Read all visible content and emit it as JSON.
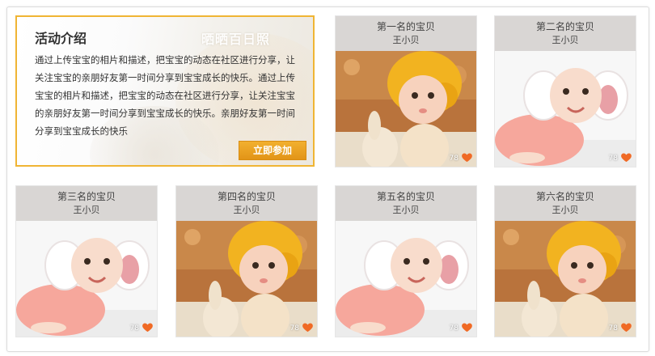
{
  "intro": {
    "title": "活动介绍",
    "watermark": "晒晒百日照",
    "body": "通过上传宝宝的相片和描述，把宝宝的动态在社区进行分享，让关注宝宝的亲朋好友第一时间分享到宝宝成长的快乐。通过上传宝宝的相片和描述，把宝宝的动态在社区进行分享，让关注宝宝的亲朋好友第一时间分享到宝宝成长的快乐。亲朋好友第一时间分享到宝宝成长的快乐",
    "join_button": "立即参加"
  },
  "cards": [
    {
      "rank": "第一名的宝贝",
      "name": "王小贝",
      "likes": "78",
      "photo": "baby-yellow-hat"
    },
    {
      "rank": "第二名的宝贝",
      "name": "王小贝",
      "likes": "78",
      "photo": "baby-pink-earmuffs"
    },
    {
      "rank": "第三名的宝贝",
      "name": "王小贝",
      "likes": "78",
      "photo": "baby-pink-earmuffs"
    },
    {
      "rank": "第四名的宝贝",
      "name": "王小贝",
      "likes": "78",
      "photo": "baby-yellow-hat"
    },
    {
      "rank": "第五名的宝贝",
      "name": "王小贝",
      "likes": "78",
      "photo": "baby-pink-earmuffs"
    },
    {
      "rank": "第六名的宝贝",
      "name": "王小贝",
      "likes": "78",
      "photo": "baby-yellow-hat"
    }
  ],
  "colors": {
    "accent": "#f0b534",
    "heart": "#f06a25",
    "card_header": "#d9d6d4"
  },
  "icons": {
    "like": "heart-icon"
  }
}
